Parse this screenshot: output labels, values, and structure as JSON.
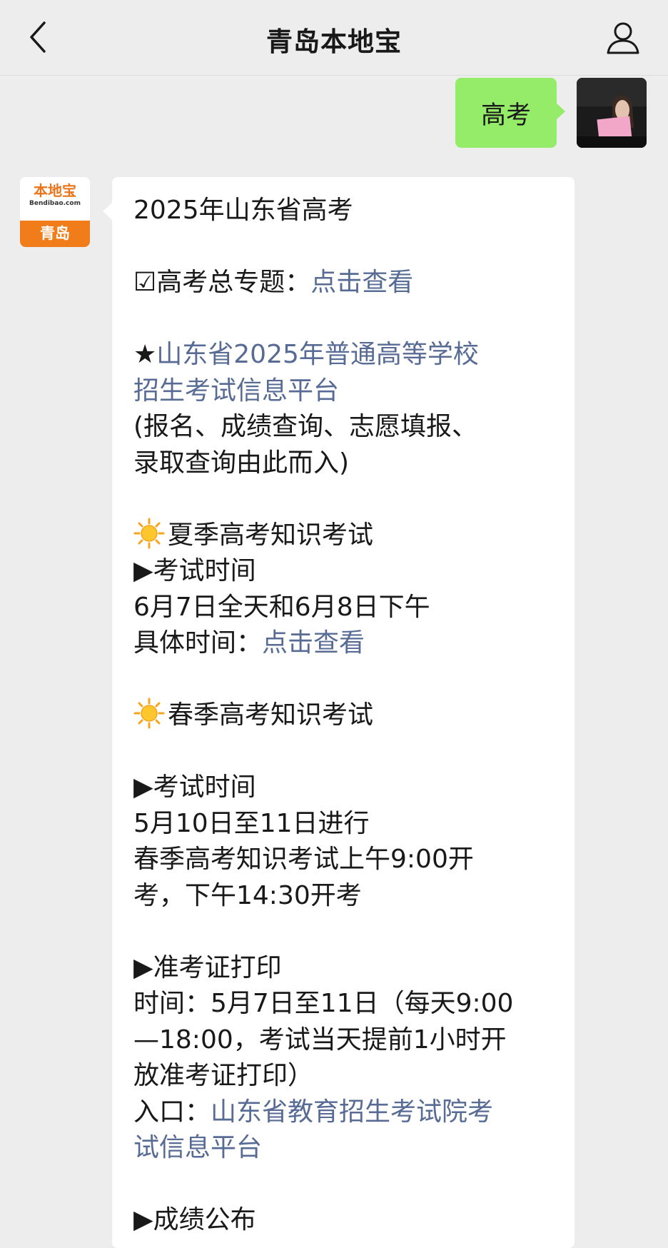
{
  "header": {
    "title": "青岛本地宝"
  },
  "sent_message": {
    "text": "高考"
  },
  "sender": {
    "avatar_brand": "本地宝",
    "avatar_domain": "Bendibao.com",
    "avatar_city": "青岛"
  },
  "reply": {
    "heading": "2025年山东省高考",
    "topic_prefix": "☑高考总专题：",
    "topic_link": "点击查看",
    "platform_star": "★",
    "platform_link_line1": "山东省2025年普通高等学校",
    "platform_link_line2": "招生考试信息平台",
    "platform_note_line1": "(报名、成绩查询、志愿填报、",
    "platform_note_line2": "录取查询由此而入)",
    "summer_title": "夏季高考知识考试",
    "summer_time_label": "▶考试时间",
    "summer_time_value": "6月7日全天和6月8日下午",
    "summer_detail_prefix": "具体时间：",
    "summer_detail_link": "点击查看",
    "spring_title": "春季高考知识考试",
    "spring_time_label": "▶考试时间",
    "spring_time_value": "5月10日至11日进行",
    "spring_time_detail_line1": "春季高考知识考试上午9:00开",
    "spring_time_detail_line2": "考，下午14:30开考",
    "print_label": "▶准考证打印",
    "print_line1": "时间：5月7日至11日（每天9:00",
    "print_line2": "—18:00，考试当天提前1小时开",
    "print_line3": "放准考证打印）",
    "entry_prefix": "入口：",
    "entry_link_line1": "山东省教育招生考试院考",
    "entry_link_line2": "试信息平台",
    "score_label": "▶成绩公布"
  },
  "colors": {
    "link": "#576b95",
    "my_bubble": "#95ec69",
    "background": "#ededed",
    "brand_orange": "#f07d19"
  }
}
